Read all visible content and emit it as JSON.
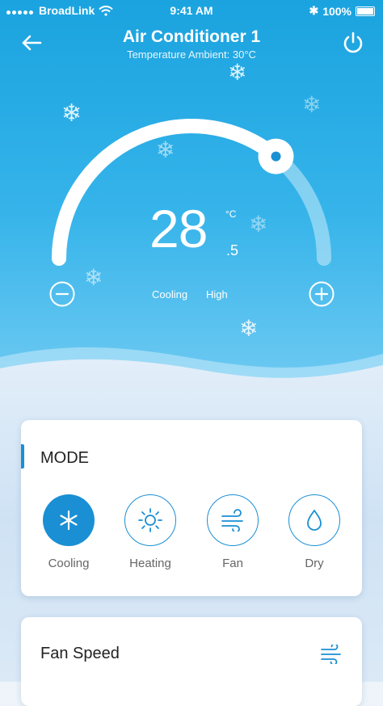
{
  "status_bar": {
    "carrier": "BroadLink",
    "time": "9:41 AM",
    "battery": "100%"
  },
  "header": {
    "title": "Air Conditioner 1",
    "subtitle": "Temperature Ambient: 30°C"
  },
  "thermostat": {
    "temperature": "28",
    "decimal": ".5",
    "unit": "°C",
    "mode_status": "Cooling",
    "fan_status": "High",
    "level": 0.72
  },
  "mode_card": {
    "title": "MODE",
    "items": [
      {
        "label": "Cooling",
        "icon": "snowflake-icon",
        "active": true
      },
      {
        "label": "Heating",
        "icon": "sun-icon",
        "active": false
      },
      {
        "label": "Fan",
        "icon": "wind-icon",
        "active": false
      },
      {
        "label": "Dry",
        "icon": "droplet-icon",
        "active": false
      }
    ]
  },
  "fan_card": {
    "title": "Fan Speed",
    "icon": "wind-icon"
  },
  "colors": {
    "accent": "#1a8fd4",
    "hero_top": "#1aa3df",
    "hero_bottom": "#6fcaf2"
  }
}
